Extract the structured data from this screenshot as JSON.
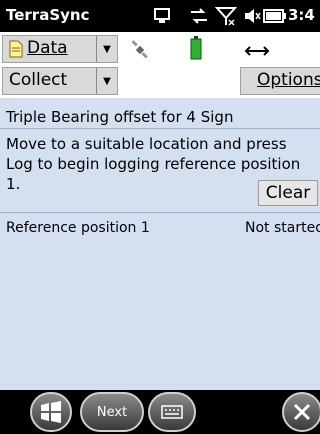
{
  "status_bar": {
    "app_title": "TerraSync",
    "clock": "3:4",
    "icons": [
      "device-sync-icon",
      "network-arrows-icon",
      "no-signal-icon",
      "volume-icon",
      "battery-icon"
    ]
  },
  "toolbar1": {
    "data_label": "Data",
    "icons": [
      "satellite-icon",
      "battery-green-icon",
      "horizontal-arrow-icon"
    ]
  },
  "toolbar2": {
    "collect_label": "Collect",
    "options_label": "Options"
  },
  "main": {
    "title": "Triple Bearing offset for 4 Sign",
    "instruction": "Move to a suitable location and press Log to begin logging reference position 1.",
    "clear_label": "Clear",
    "reference_label": "Reference position 1",
    "reference_status": "Not started"
  },
  "bottom_bar": {
    "next_label": "Next",
    "icons": [
      "windows-start-icon",
      "keyboard-icon",
      "close-icon"
    ]
  }
}
